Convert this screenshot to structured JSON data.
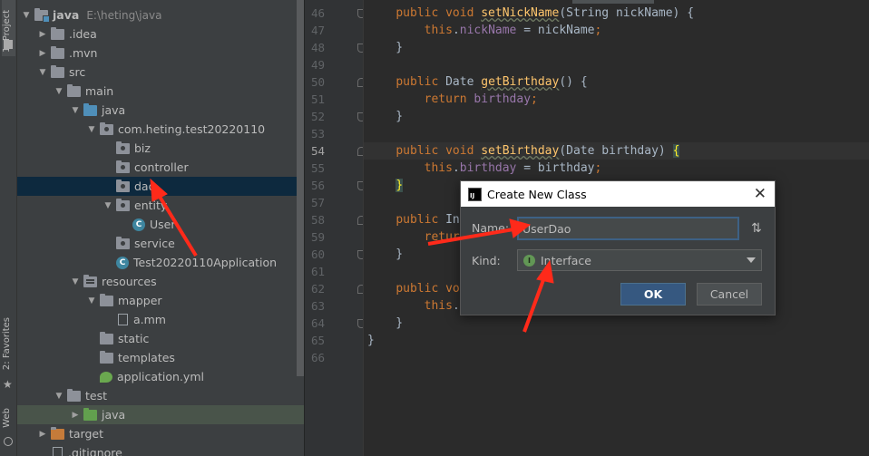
{
  "sidebar": {
    "project_tab": "1: Project",
    "favorites_tab": "2: Favorites",
    "web_tab": "Web"
  },
  "tree": [
    {
      "label": "java",
      "path": "E:\\heting\\java",
      "expanded": true,
      "icon": "module-folder-icon",
      "depth": 0
    },
    {
      "label": ".idea",
      "expanded": false,
      "icon": "folder-icon",
      "depth": 1
    },
    {
      "label": ".mvn",
      "expanded": false,
      "icon": "folder-icon",
      "depth": 1
    },
    {
      "label": "src",
      "expanded": true,
      "icon": "folder-icon",
      "depth": 1
    },
    {
      "label": "main",
      "expanded": true,
      "icon": "folder-icon",
      "depth": 2
    },
    {
      "label": "java",
      "expanded": true,
      "icon": "source-folder-icon",
      "depth": 3
    },
    {
      "label": "com.heting.test20220110",
      "expanded": true,
      "icon": "package-icon",
      "depth": 4
    },
    {
      "label": "biz",
      "icon": "package-icon",
      "depth": 5
    },
    {
      "label": "controller",
      "icon": "package-icon",
      "depth": 5
    },
    {
      "label": "dao",
      "icon": "package-icon",
      "depth": 5,
      "selected": true
    },
    {
      "label": "entity",
      "expanded": true,
      "icon": "package-icon",
      "depth": 5
    },
    {
      "label": "User",
      "icon": "class-icon",
      "depth": 6
    },
    {
      "label": "service",
      "icon": "package-icon",
      "depth": 5
    },
    {
      "label": "Test20220110Application",
      "icon": "spring-class-icon",
      "depth": 5
    },
    {
      "label": "resources",
      "expanded": true,
      "icon": "resources-folder-icon",
      "depth": 3
    },
    {
      "label": "mapper",
      "expanded": true,
      "icon": "folder-icon",
      "depth": 4
    },
    {
      "label": "a.mm",
      "icon": "file-icon",
      "depth": 5
    },
    {
      "label": "static",
      "icon": "folder-icon",
      "depth": 4
    },
    {
      "label": "templates",
      "icon": "folder-icon",
      "depth": 4
    },
    {
      "label": "application.yml",
      "icon": "yml-icon",
      "depth": 4
    },
    {
      "label": "test",
      "expanded": true,
      "icon": "folder-icon",
      "depth": 2
    },
    {
      "label": "java",
      "expanded": false,
      "icon": "test-folder-icon",
      "depth": 3,
      "highlight": true
    },
    {
      "label": "target",
      "expanded": false,
      "icon": "target-folder-icon",
      "depth": 1
    },
    {
      "label": ".gitignore",
      "icon": "file-icon",
      "depth": 1
    }
  ],
  "editor": {
    "line_numbers": [
      "46",
      "47",
      "48",
      "49",
      "50",
      "51",
      "52",
      "53",
      "54",
      "55",
      "56",
      "57",
      "58",
      "59",
      "60",
      "61",
      "62",
      "63",
      "64",
      "65",
      "66"
    ],
    "current_line": "54"
  },
  "dialog": {
    "title": "Create New Class",
    "name_label": "Name:",
    "name_value": "UserDao",
    "kind_label": "Kind:",
    "kind_value": "Interface",
    "ok_label": "OK",
    "cancel_label": "Cancel"
  },
  "colors": {
    "annotation_arrow": "#ff2a1a",
    "selection": "#0d293e",
    "ok_button": "#365880"
  }
}
